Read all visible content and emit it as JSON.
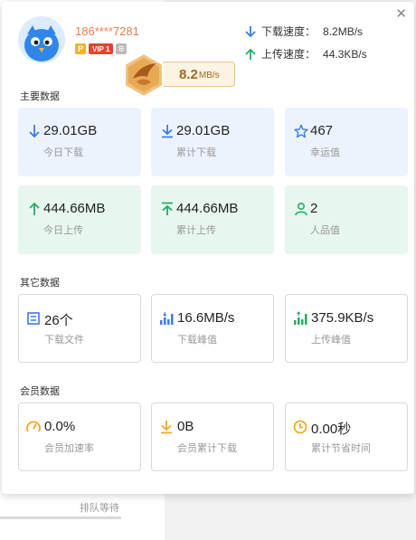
{
  "background": {
    "queue_label": "排队等待"
  },
  "user": {
    "name": "186****7281",
    "badge_p": "P",
    "badge_vip": "VIP 1",
    "badge_year": "年"
  },
  "current_speed": {
    "value": "8.2",
    "unit": "MB/s"
  },
  "speeds": {
    "download_label": "下载速度：",
    "download_value": "8.2MB/s",
    "upload_label": "上传速度：",
    "upload_value": "44.3KB/s"
  },
  "main_data": {
    "title": "主要数据",
    "cards": [
      {
        "value": "29.01GB",
        "label": "今日下载",
        "icon": "download-arrow-icon"
      },
      {
        "value": "29.01GB",
        "label": "累计下载",
        "icon": "download-to-bottom-icon"
      },
      {
        "value": "467",
        "label": "幸运值",
        "icon": "star-icon"
      },
      {
        "value": "444.66MB",
        "label": "今日上传",
        "icon": "upload-arrow-icon"
      },
      {
        "value": "444.66MB",
        "label": "累计上传",
        "icon": "upload-to-top-icon"
      },
      {
        "value": "2",
        "label": "人品值",
        "icon": "person-icon"
      }
    ]
  },
  "other_data": {
    "title": "其它数据",
    "cards": [
      {
        "value": "26个",
        "label": "下载文件",
        "icon": "file-list-icon"
      },
      {
        "value": "16.6MB/s",
        "label": "下载峰值",
        "icon": "download-peak-icon"
      },
      {
        "value": "375.9KB/s",
        "label": "上传峰值",
        "icon": "upload-peak-icon"
      }
    ]
  },
  "member_data": {
    "title": "会员数据",
    "cards": [
      {
        "value": "0.0%",
        "label": "会员加速率",
        "icon": "speedometer-icon"
      },
      {
        "value": "0B",
        "label": "会员累计下载",
        "icon": "member-download-icon"
      },
      {
        "value": "0.00秒",
        "label": "累计节省时间",
        "icon": "clock-icon"
      }
    ]
  },
  "colors": {
    "blue": "#3b7bea",
    "green": "#1fae6a",
    "orange": "#f5a623",
    "username": "#f07c4a"
  }
}
